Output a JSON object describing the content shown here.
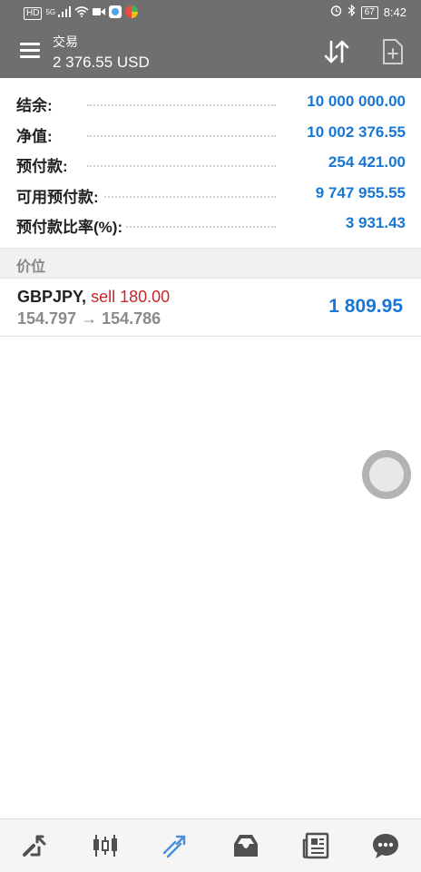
{
  "status_bar": {
    "left_icons": [
      "hd-icon",
      "5g-signal-icon",
      "wifi-icon",
      "video-icon",
      "app-icon",
      "app-icon-2"
    ],
    "hd_label": "HD",
    "net_label": "5G",
    "battery": "67",
    "time": "8:42"
  },
  "app_bar": {
    "title": "交易",
    "subtitle": "2 376.55 USD"
  },
  "summary": [
    {
      "label": "结余:",
      "value": "10 000 000.00"
    },
    {
      "label": "净值:",
      "value": "10 002 376.55"
    },
    {
      "label": "预付款:",
      "value": "254 421.00"
    },
    {
      "label": "可用预付款:",
      "value": "9 747 955.55"
    },
    {
      "label": "预付款比率(%):",
      "value": "3 931.43"
    }
  ],
  "section": {
    "title": "价位"
  },
  "position": {
    "symbol": "GBPJPY,",
    "direction": "sell 180.00",
    "prices": "154.797 → 154.786",
    "profit": "1 809.95"
  },
  "bottom_nav": [
    {
      "name": "quotes-icon"
    },
    {
      "name": "chart-candles-icon"
    },
    {
      "name": "trade-icon",
      "active": true
    },
    {
      "name": "history-icon"
    },
    {
      "name": "news-icon"
    },
    {
      "name": "chat-icon"
    }
  ],
  "colors": {
    "header_bg": "#6f6f6f",
    "value_blue": "#1976d2",
    "sell_red": "#c62828",
    "active_nav": "#4a90d9",
    "inactive_nav": "#505050"
  }
}
